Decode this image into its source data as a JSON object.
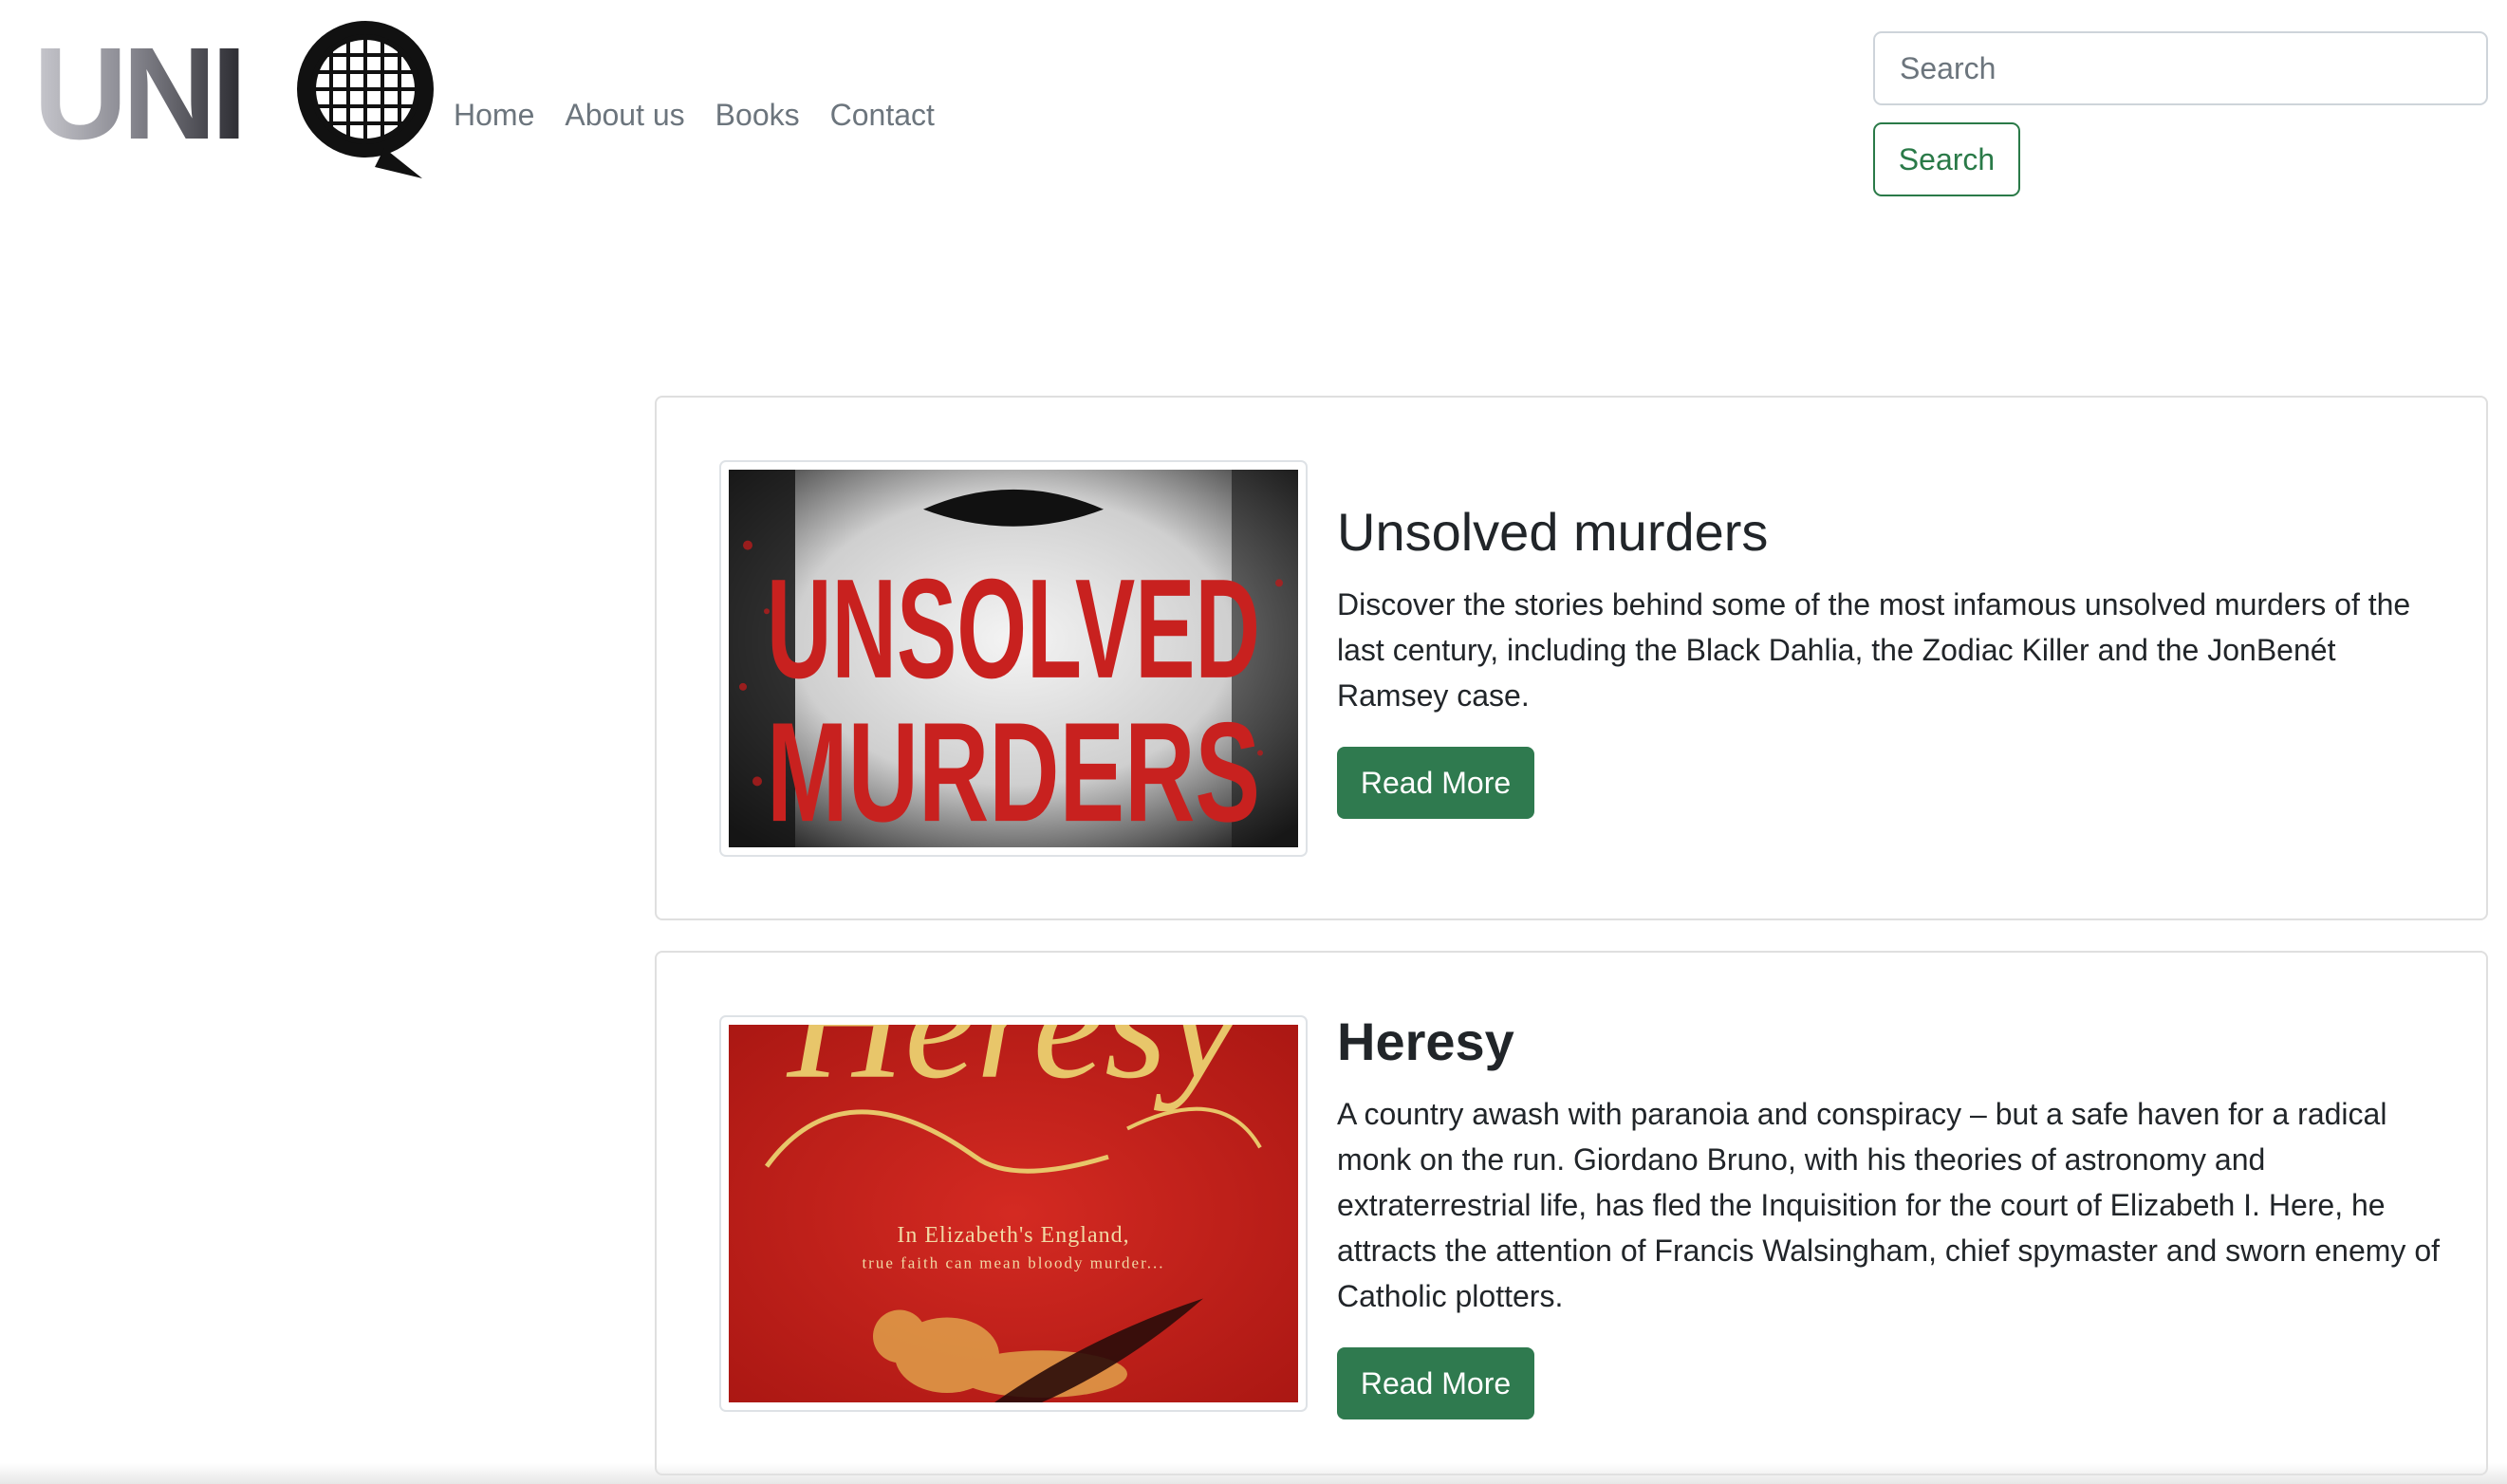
{
  "brand": {
    "logo_text": "UNIQ"
  },
  "nav": {
    "items": [
      {
        "label": "Home"
      },
      {
        "label": "About us"
      },
      {
        "label": "Books"
      },
      {
        "label": "Contact"
      }
    ]
  },
  "search": {
    "placeholder": "Search",
    "value": "",
    "button_label": "Search",
    "accent": "#2a7a48"
  },
  "books": [
    {
      "title": "Unsolved murders",
      "description": "Discover the stories behind some of the most infamous unsolved murders of the last century, including the Black Dahlia, the Zodiac Killer and the JonBenét Ramsey case.",
      "button_label": "Read More",
      "cover_text": [
        "UNSOLVED",
        "MURDERS"
      ]
    },
    {
      "title": "Heresy",
      "description": "A country awash with paranoia and conspiracy – but a safe haven for a radical monk on the run. Giordano Bruno, with his theories of astronomy and extraterrestrial life, has fled the Inquisition for the court of Elizabeth I. Here, he attracts the attention of Francis Walsingham, chief spymaster and sworn enemy of Catholic plotters.",
      "button_label": "Read More",
      "cover_text": [
        "Heresy",
        "In Elizabeth's England,",
        "true faith can mean bloody murder..."
      ]
    }
  ],
  "colors": {
    "primary_button": "#2f7a4f",
    "cover_red": "#c8211f",
    "cover_gold": "#e8c66a"
  }
}
